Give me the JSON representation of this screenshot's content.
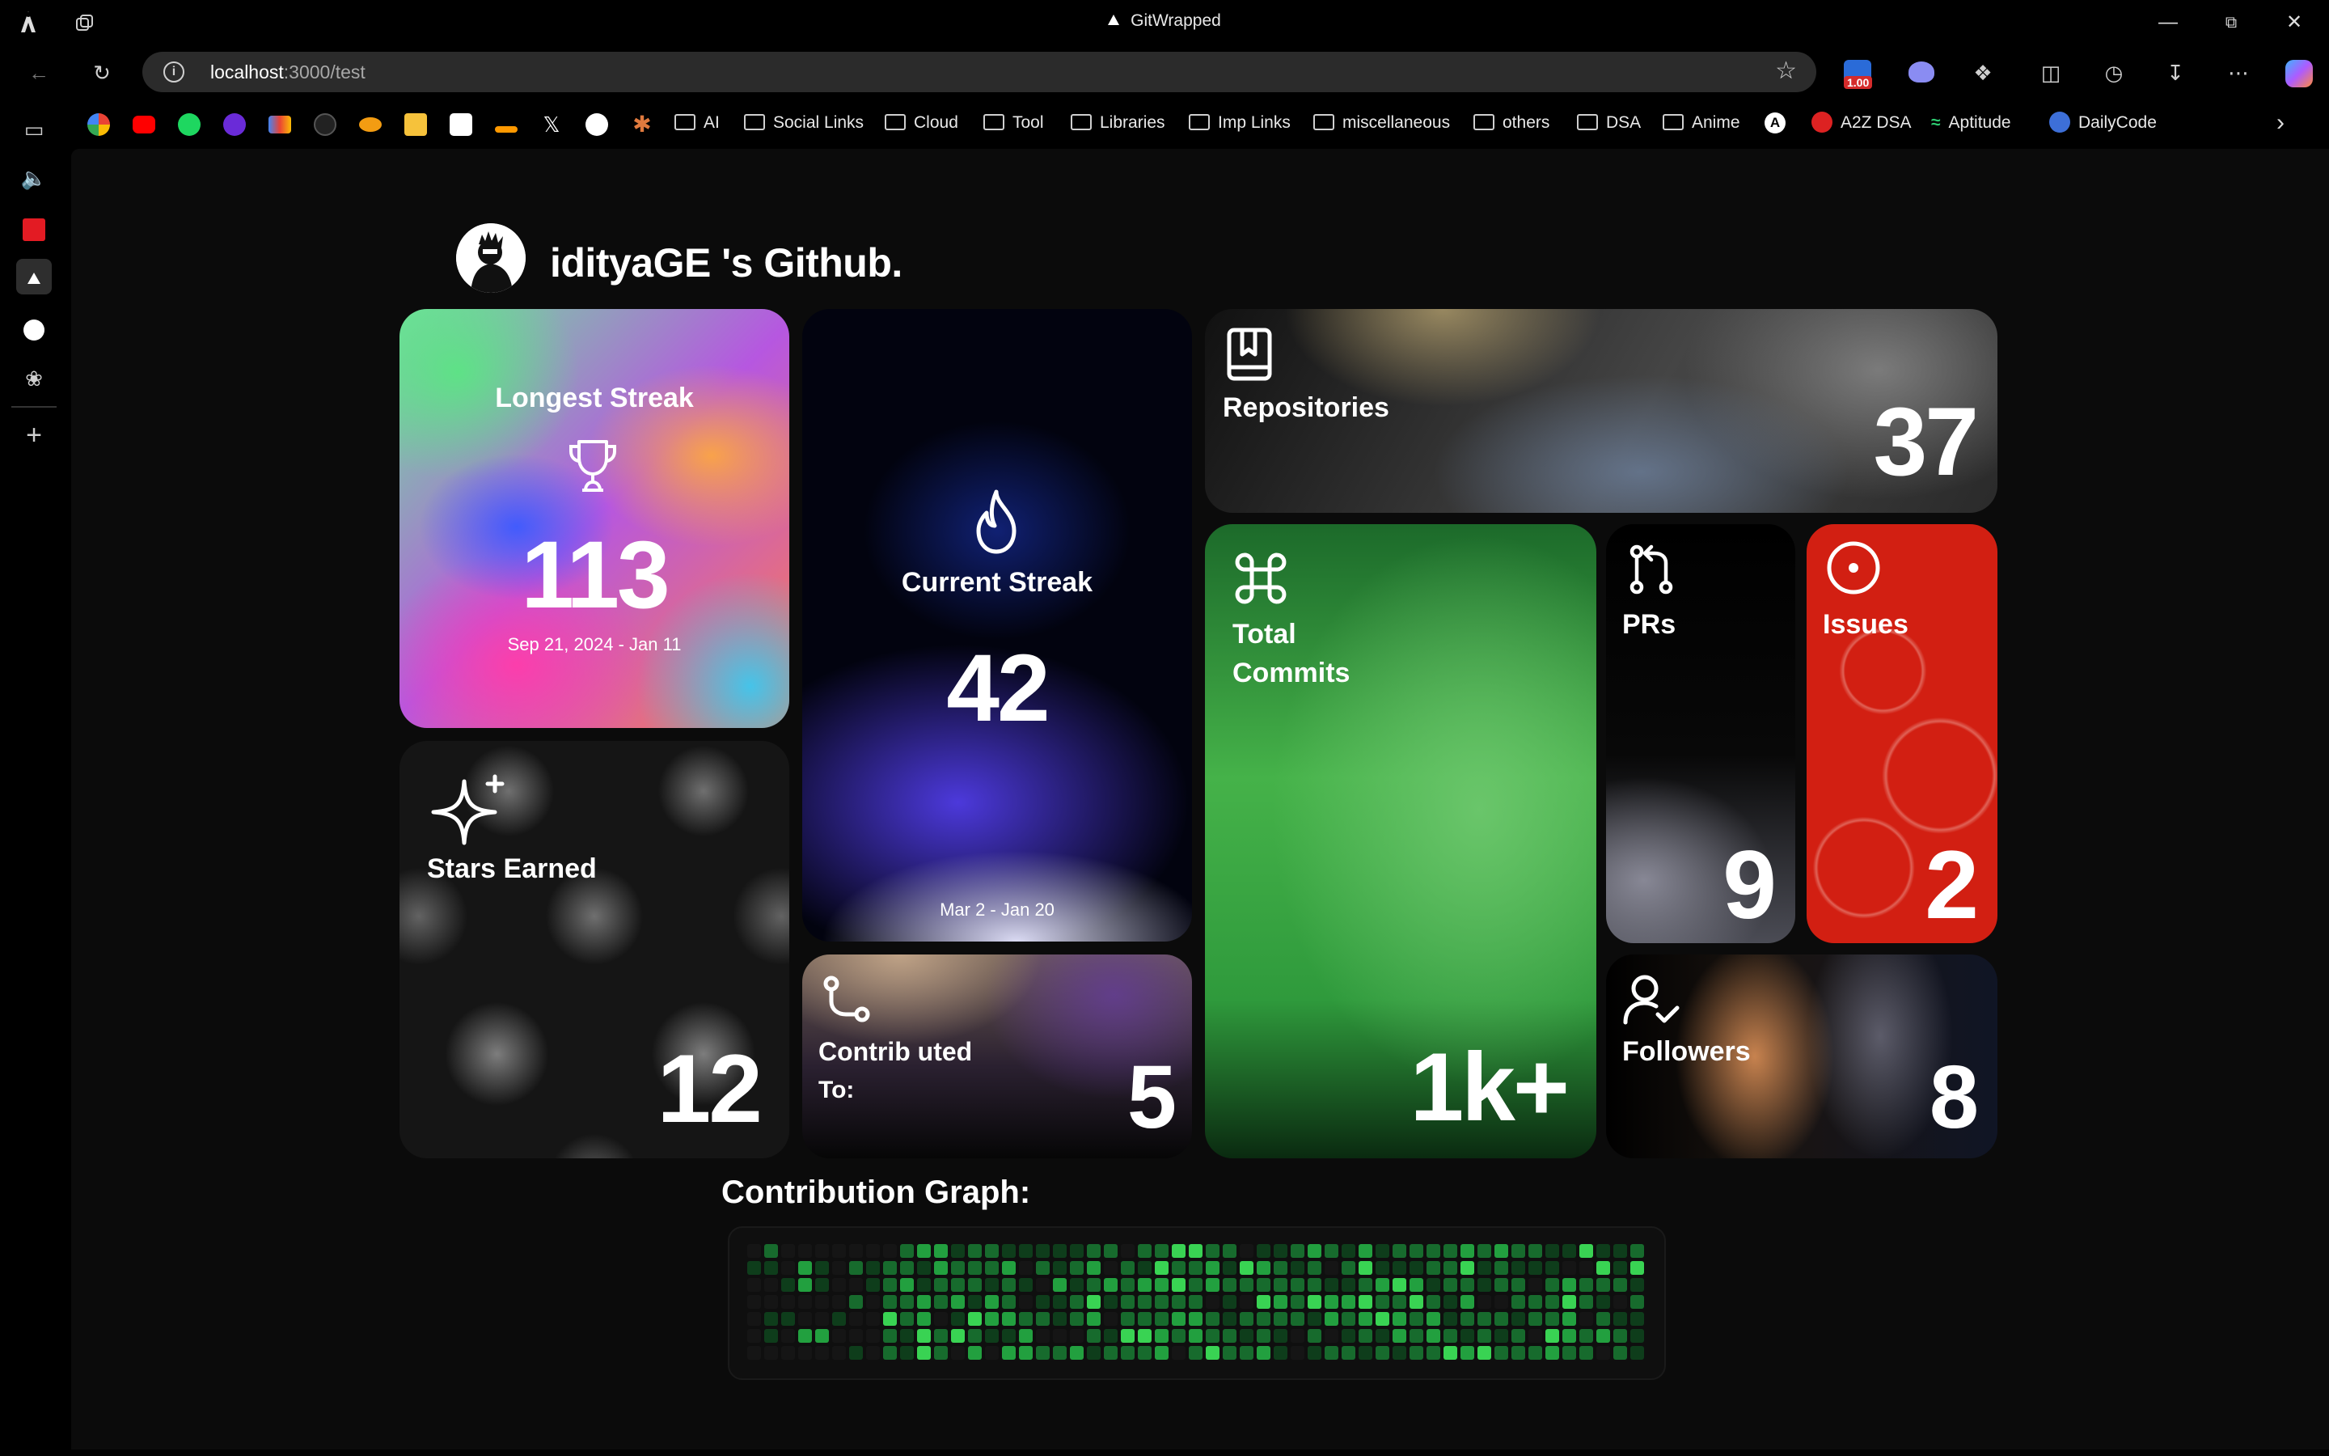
{
  "browser": {
    "window_title": "GitWrapped",
    "url_host": "localhost",
    "url_path": ":3000/test",
    "bookmarks": [
      {
        "label": "AI",
        "type": "folder"
      },
      {
        "label": "Social Links",
        "type": "folder"
      },
      {
        "label": "Cloud",
        "type": "folder"
      },
      {
        "label": "Tool",
        "type": "folder"
      },
      {
        "label": "Libraries",
        "type": "folder"
      },
      {
        "label": "Imp Links",
        "type": "folder"
      },
      {
        "label": "miscellaneous",
        "type": "folder"
      },
      {
        "label": "others",
        "type": "folder"
      },
      {
        "label": "DSA",
        "type": "folder"
      },
      {
        "label": "Anime",
        "type": "folder"
      },
      {
        "label": "A2Z DSA",
        "type": "link"
      },
      {
        "label": "Aptitude",
        "type": "link"
      },
      {
        "label": "DailyCode",
        "type": "link"
      }
    ],
    "extension_badge": "1.00"
  },
  "profile": {
    "heading": "idityaGE 's Github."
  },
  "cards": {
    "longest_streak": {
      "label": "Longest Streak",
      "value": "113",
      "range": "Sep 21, 2024 - Jan 11"
    },
    "current_streak": {
      "label": "Current Streak",
      "value": "42",
      "range": "Mar 2 - Jan 20"
    },
    "repositories": {
      "label": "Repositories",
      "value": "37"
    },
    "stars": {
      "label": "Stars Earned",
      "value": "12"
    },
    "commits": {
      "label_line1": "Total",
      "label_line2": "Commits",
      "value": "1k+"
    },
    "prs": {
      "label": "PRs",
      "value": "9"
    },
    "issues": {
      "label": "Issues",
      "value": "2"
    },
    "contributed": {
      "label_line1": "Contrib uted",
      "label_line2": "To:",
      "value": "5"
    },
    "followers": {
      "label": "Followers",
      "value": "8"
    }
  },
  "contribution_graph": {
    "title": "Contribution Graph:",
    "colors": [
      "#151515",
      "#0e3d1b",
      "#176b2d",
      "#22a03f",
      "#39d353"
    ]
  }
}
